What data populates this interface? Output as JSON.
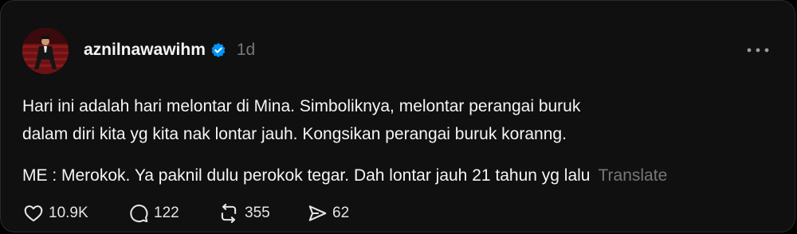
{
  "post": {
    "username": "aznilnawawihm",
    "time": "1d",
    "text_line1": "Hari ini adalah hari melontar di Mina. Simboliknya, melontar perangai buruk",
    "text_line2": "dalam diri kita yg kita nak lontar jauh. Kongsikan perangai buruk koranng.",
    "text_para2": "ME : Merokok. Ya paknil dulu perokok tegar. Dah lontar jauh 21 tahun yg lalu",
    "translate_label": "Translate"
  },
  "actions": {
    "likes": "10.9K",
    "replies": "122",
    "reposts": "355",
    "shares": "62"
  },
  "icons": {
    "verified": "verified-badge-icon",
    "more": "more-dots-icon",
    "like": "heart-icon",
    "reply": "comment-bubble-icon",
    "repost": "repost-icon",
    "share": "send-icon"
  },
  "colors": {
    "background": "#101010",
    "text": "#f3f5f7",
    "muted": "#777777",
    "verified": "#0095f6"
  }
}
